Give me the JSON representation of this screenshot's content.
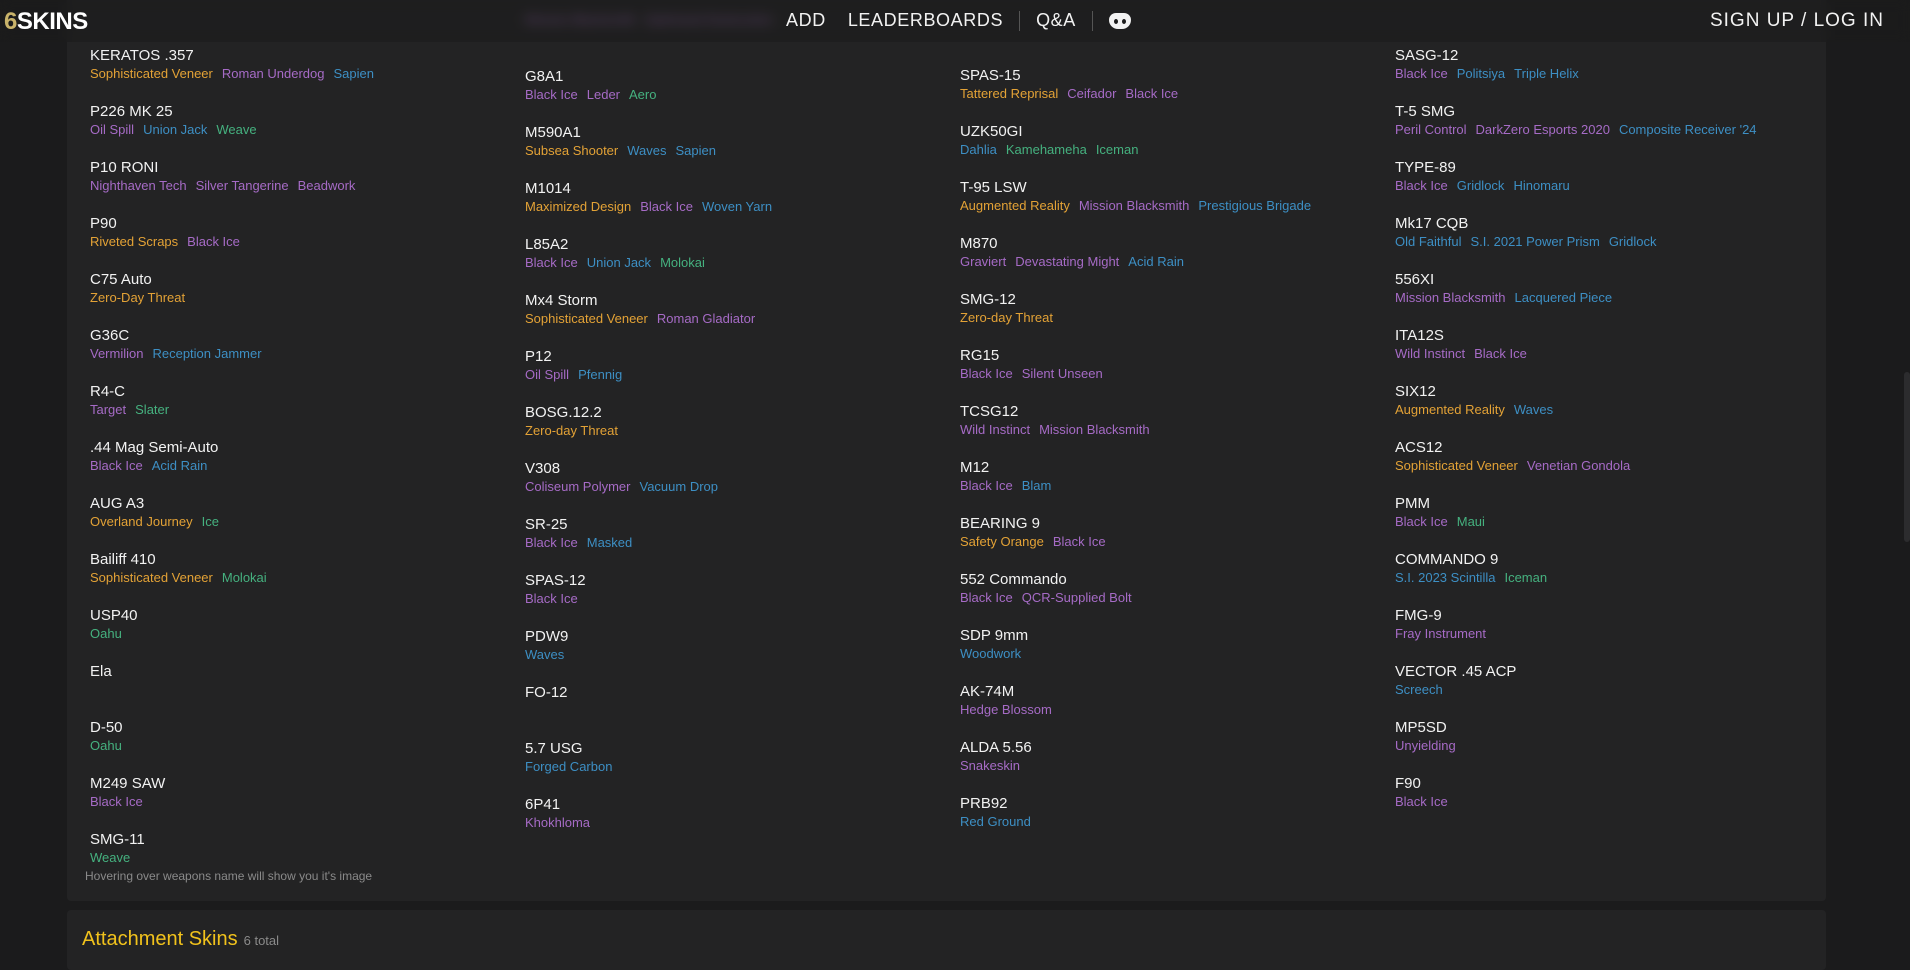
{
  "header": {
    "logo_six": "6",
    "logo_text": "SKINS",
    "nav": [
      "ADD",
      "LEADERBOARDS",
      "Q&A"
    ],
    "discord_icon": "discord-icon",
    "signup": "SIGN UP / LOG IN"
  },
  "colors": {
    "orange": "#e3a236",
    "purple": "#a66bc6",
    "blue": "#3d8fc4",
    "green": "#45b17f",
    "title": "#f1c21c"
  },
  "columns": [
    [
      {
        "name": "KERATOS .357",
        "skins": [
          [
            "Sophisticated Veneer",
            "o"
          ],
          [
            "Roman Underdog",
            "p"
          ],
          [
            "Sapien",
            "b"
          ]
        ]
      },
      {
        "name": "P226 MK 25",
        "skins": [
          [
            "Oil Spill",
            "p"
          ],
          [
            "Union Jack",
            "b"
          ],
          [
            "Weave",
            "g"
          ]
        ]
      },
      {
        "name": "P10 RONI",
        "skins": [
          [
            "Nighthaven Tech",
            "p"
          ],
          [
            "Silver Tangerine",
            "p"
          ],
          [
            "Beadwork",
            "p"
          ]
        ]
      },
      {
        "name": "P90",
        "skins": [
          [
            "Riveted Scraps",
            "o"
          ],
          [
            "Black Ice",
            "p"
          ]
        ]
      },
      {
        "name": "C75 Auto",
        "skins": [
          [
            "Zero-Day Threat",
            "o"
          ]
        ]
      },
      {
        "name": "G36C",
        "skins": [
          [
            "Vermilion",
            "p"
          ],
          [
            "Reception Jammer",
            "b"
          ]
        ]
      },
      {
        "name": "R4-C",
        "skins": [
          [
            "Target",
            "p"
          ],
          [
            "Slater",
            "g"
          ]
        ]
      },
      {
        "name": ".44 Mag Semi-Auto",
        "skins": [
          [
            "Black Ice",
            "p"
          ],
          [
            "Acid Rain",
            "b"
          ]
        ]
      },
      {
        "name": "AUG A3",
        "skins": [
          [
            "Overland Journey",
            "o"
          ],
          [
            "Ice",
            "g"
          ]
        ]
      },
      {
        "name": "Bailiff 410",
        "skins": [
          [
            "Sophisticated Veneer",
            "o"
          ],
          [
            "Molokai",
            "g"
          ]
        ]
      },
      {
        "name": "USP40",
        "skins": [
          [
            "Oahu",
            "g"
          ]
        ]
      },
      {
        "name": "Ela",
        "skins": []
      },
      {
        "name": "D-50",
        "skins": [
          [
            "Oahu",
            "g"
          ]
        ]
      },
      {
        "name": "M249 SAW",
        "skins": [
          [
            "Black Ice",
            "p"
          ]
        ]
      },
      {
        "name": "SMG-11",
        "skins": [
          [
            "Weave",
            "g"
          ]
        ]
      }
    ],
    [
      {
        "name": "",
        "skins": [
          [
            "Mission Blacksmith",
            "p"
          ],
          [
            "Optimized Destruction",
            "p"
          ]
        ]
      },
      {
        "name": "G8A1",
        "skins": [
          [
            "Black Ice",
            "p"
          ],
          [
            "Leder",
            "p"
          ],
          [
            "Aero",
            "g"
          ]
        ]
      },
      {
        "name": "M590A1",
        "skins": [
          [
            "Subsea Shooter",
            "o"
          ],
          [
            "Waves",
            "b"
          ],
          [
            "Sapien",
            "b"
          ]
        ]
      },
      {
        "name": "M1014",
        "skins": [
          [
            "Maximized Design",
            "o"
          ],
          [
            "Black Ice",
            "p"
          ],
          [
            "Woven Yarn",
            "b"
          ]
        ]
      },
      {
        "name": "L85A2",
        "skins": [
          [
            "Black Ice",
            "p"
          ],
          [
            "Union Jack",
            "b"
          ],
          [
            "Molokai",
            "g"
          ]
        ]
      },
      {
        "name": "Mx4 Storm",
        "skins": [
          [
            "Sophisticated Veneer",
            "o"
          ],
          [
            "Roman Gladiator",
            "p"
          ]
        ]
      },
      {
        "name": "P12",
        "skins": [
          [
            "Oil Spill",
            "p"
          ],
          [
            "Pfennig",
            "b"
          ]
        ]
      },
      {
        "name": "BOSG.12.2",
        "skins": [
          [
            "Zero-day Threat",
            "o"
          ]
        ]
      },
      {
        "name": "V308",
        "skins": [
          [
            "Coliseum Polymer",
            "p"
          ],
          [
            "Vacuum Drop",
            "b"
          ]
        ]
      },
      {
        "name": "SR-25",
        "skins": [
          [
            "Black Ice",
            "p"
          ],
          [
            "Masked",
            "b"
          ]
        ]
      },
      {
        "name": "SPAS-12",
        "skins": [
          [
            "Black Ice",
            "p"
          ]
        ]
      },
      {
        "name": "PDW9",
        "skins": [
          [
            "Waves",
            "b"
          ]
        ]
      },
      {
        "name": "FO-12",
        "skins": []
      },
      {
        "name": "5.7 USG",
        "skins": [
          [
            "Forged Carbon",
            "b"
          ]
        ]
      },
      {
        "name": "6P41",
        "skins": [
          [
            "Khokhloma",
            "p"
          ]
        ]
      }
    ],
    [
      {
        "name": "SPAS-15",
        "skins": [
          [
            "Tattered Reprisal",
            "o"
          ],
          [
            "Ceifador",
            "p"
          ],
          [
            "Black Ice",
            "p"
          ]
        ]
      },
      {
        "name": "UZK50GI",
        "skins": [
          [
            "Dahlia",
            "b"
          ],
          [
            "Kamehameha",
            "g"
          ],
          [
            "Iceman",
            "g"
          ]
        ]
      },
      {
        "name": "T-95 LSW",
        "skins": [
          [
            "Augmented Reality",
            "o"
          ],
          [
            "Mission Blacksmith",
            "p"
          ],
          [
            "Prestigious Brigade",
            "b"
          ]
        ]
      },
      {
        "name": "M870",
        "skins": [
          [
            "Graviert",
            "p"
          ],
          [
            "Devastating Might",
            "p"
          ],
          [
            "Acid Rain",
            "b"
          ]
        ]
      },
      {
        "name": "SMG-12",
        "skins": [
          [
            "Zero-day Threat",
            "o"
          ]
        ]
      },
      {
        "name": "RG15",
        "skins": [
          [
            "Black Ice",
            "p"
          ],
          [
            "Silent Unseen",
            "p"
          ]
        ]
      },
      {
        "name": "TCSG12",
        "skins": [
          [
            "Wild Instinct",
            "p"
          ],
          [
            "Mission Blacksmith",
            "p"
          ]
        ]
      },
      {
        "name": "M12",
        "skins": [
          [
            "Black Ice",
            "p"
          ],
          [
            "Blam",
            "b"
          ]
        ]
      },
      {
        "name": "BEARING 9",
        "skins": [
          [
            "Safety Orange",
            "o"
          ],
          [
            "Black Ice",
            "p"
          ]
        ]
      },
      {
        "name": "552 Commando",
        "skins": [
          [
            "Black Ice",
            "p"
          ],
          [
            "QCR-Supplied Bolt",
            "p"
          ]
        ]
      },
      {
        "name": "SDP 9mm",
        "skins": [
          [
            "Woodwork",
            "b"
          ]
        ]
      },
      {
        "name": "AK-74M",
        "skins": [
          [
            "Hedge Blossom",
            "p"
          ]
        ]
      },
      {
        "name": "ALDA 5.56",
        "skins": [
          [
            "Snakeskin",
            "p"
          ]
        ]
      },
      {
        "name": "PRB92",
        "skins": [
          [
            "Red Ground",
            "b"
          ]
        ]
      }
    ],
    [
      {
        "name": "SASG-12",
        "skins": [
          [
            "Black Ice",
            "p"
          ],
          [
            "Politsiya",
            "b"
          ],
          [
            "Triple Helix",
            "b"
          ]
        ]
      },
      {
        "name": "T-5 SMG",
        "skins": [
          [
            "Peril Control",
            "p"
          ],
          [
            "DarkZero Esports 2020",
            "p"
          ],
          [
            "Composite Receiver '24",
            "b"
          ]
        ]
      },
      {
        "name": "TYPE-89",
        "skins": [
          [
            "Black Ice",
            "p"
          ],
          [
            "Gridlock",
            "b"
          ],
          [
            "Hinomaru",
            "b"
          ]
        ]
      },
      {
        "name": "Mk17 CQB",
        "skins": [
          [
            "Old Faithful",
            "b"
          ],
          [
            "S.I. 2021 Power Prism",
            "b"
          ],
          [
            "Gridlock",
            "b"
          ]
        ]
      },
      {
        "name": "556XI",
        "skins": [
          [
            "Mission Blacksmith",
            "p"
          ],
          [
            "Lacquered Piece",
            "b"
          ]
        ]
      },
      {
        "name": "ITA12S",
        "skins": [
          [
            "Wild Instinct",
            "p"
          ],
          [
            "Black Ice",
            "p"
          ]
        ]
      },
      {
        "name": "SIX12",
        "skins": [
          [
            "Augmented Reality",
            "o"
          ],
          [
            "Waves",
            "b"
          ]
        ]
      },
      {
        "name": "ACS12",
        "skins": [
          [
            "Sophisticated Veneer",
            "o"
          ],
          [
            "Venetian Gondola",
            "p"
          ]
        ]
      },
      {
        "name": "PMM",
        "skins": [
          [
            "Black Ice",
            "p"
          ],
          [
            "Maui",
            "g"
          ]
        ]
      },
      {
        "name": "COMMANDO 9",
        "skins": [
          [
            "S.I. 2023 Scintilla",
            "b"
          ],
          [
            "Iceman",
            "g"
          ]
        ]
      },
      {
        "name": "FMG-9",
        "skins": [
          [
            "Fray Instrument",
            "p"
          ]
        ]
      },
      {
        "name": "VECTOR .45 ACP",
        "skins": [
          [
            "Screech",
            "b"
          ]
        ]
      },
      {
        "name": "MP5SD",
        "skins": [
          [
            "Unyielding",
            "p"
          ]
        ]
      },
      {
        "name": "F90",
        "skins": [
          [
            "Black Ice",
            "p"
          ]
        ]
      }
    ]
  ],
  "note": "Hovering over weapons name will show you it's image",
  "attachments": {
    "title": "Attachment Skins",
    "count": "6 total"
  }
}
